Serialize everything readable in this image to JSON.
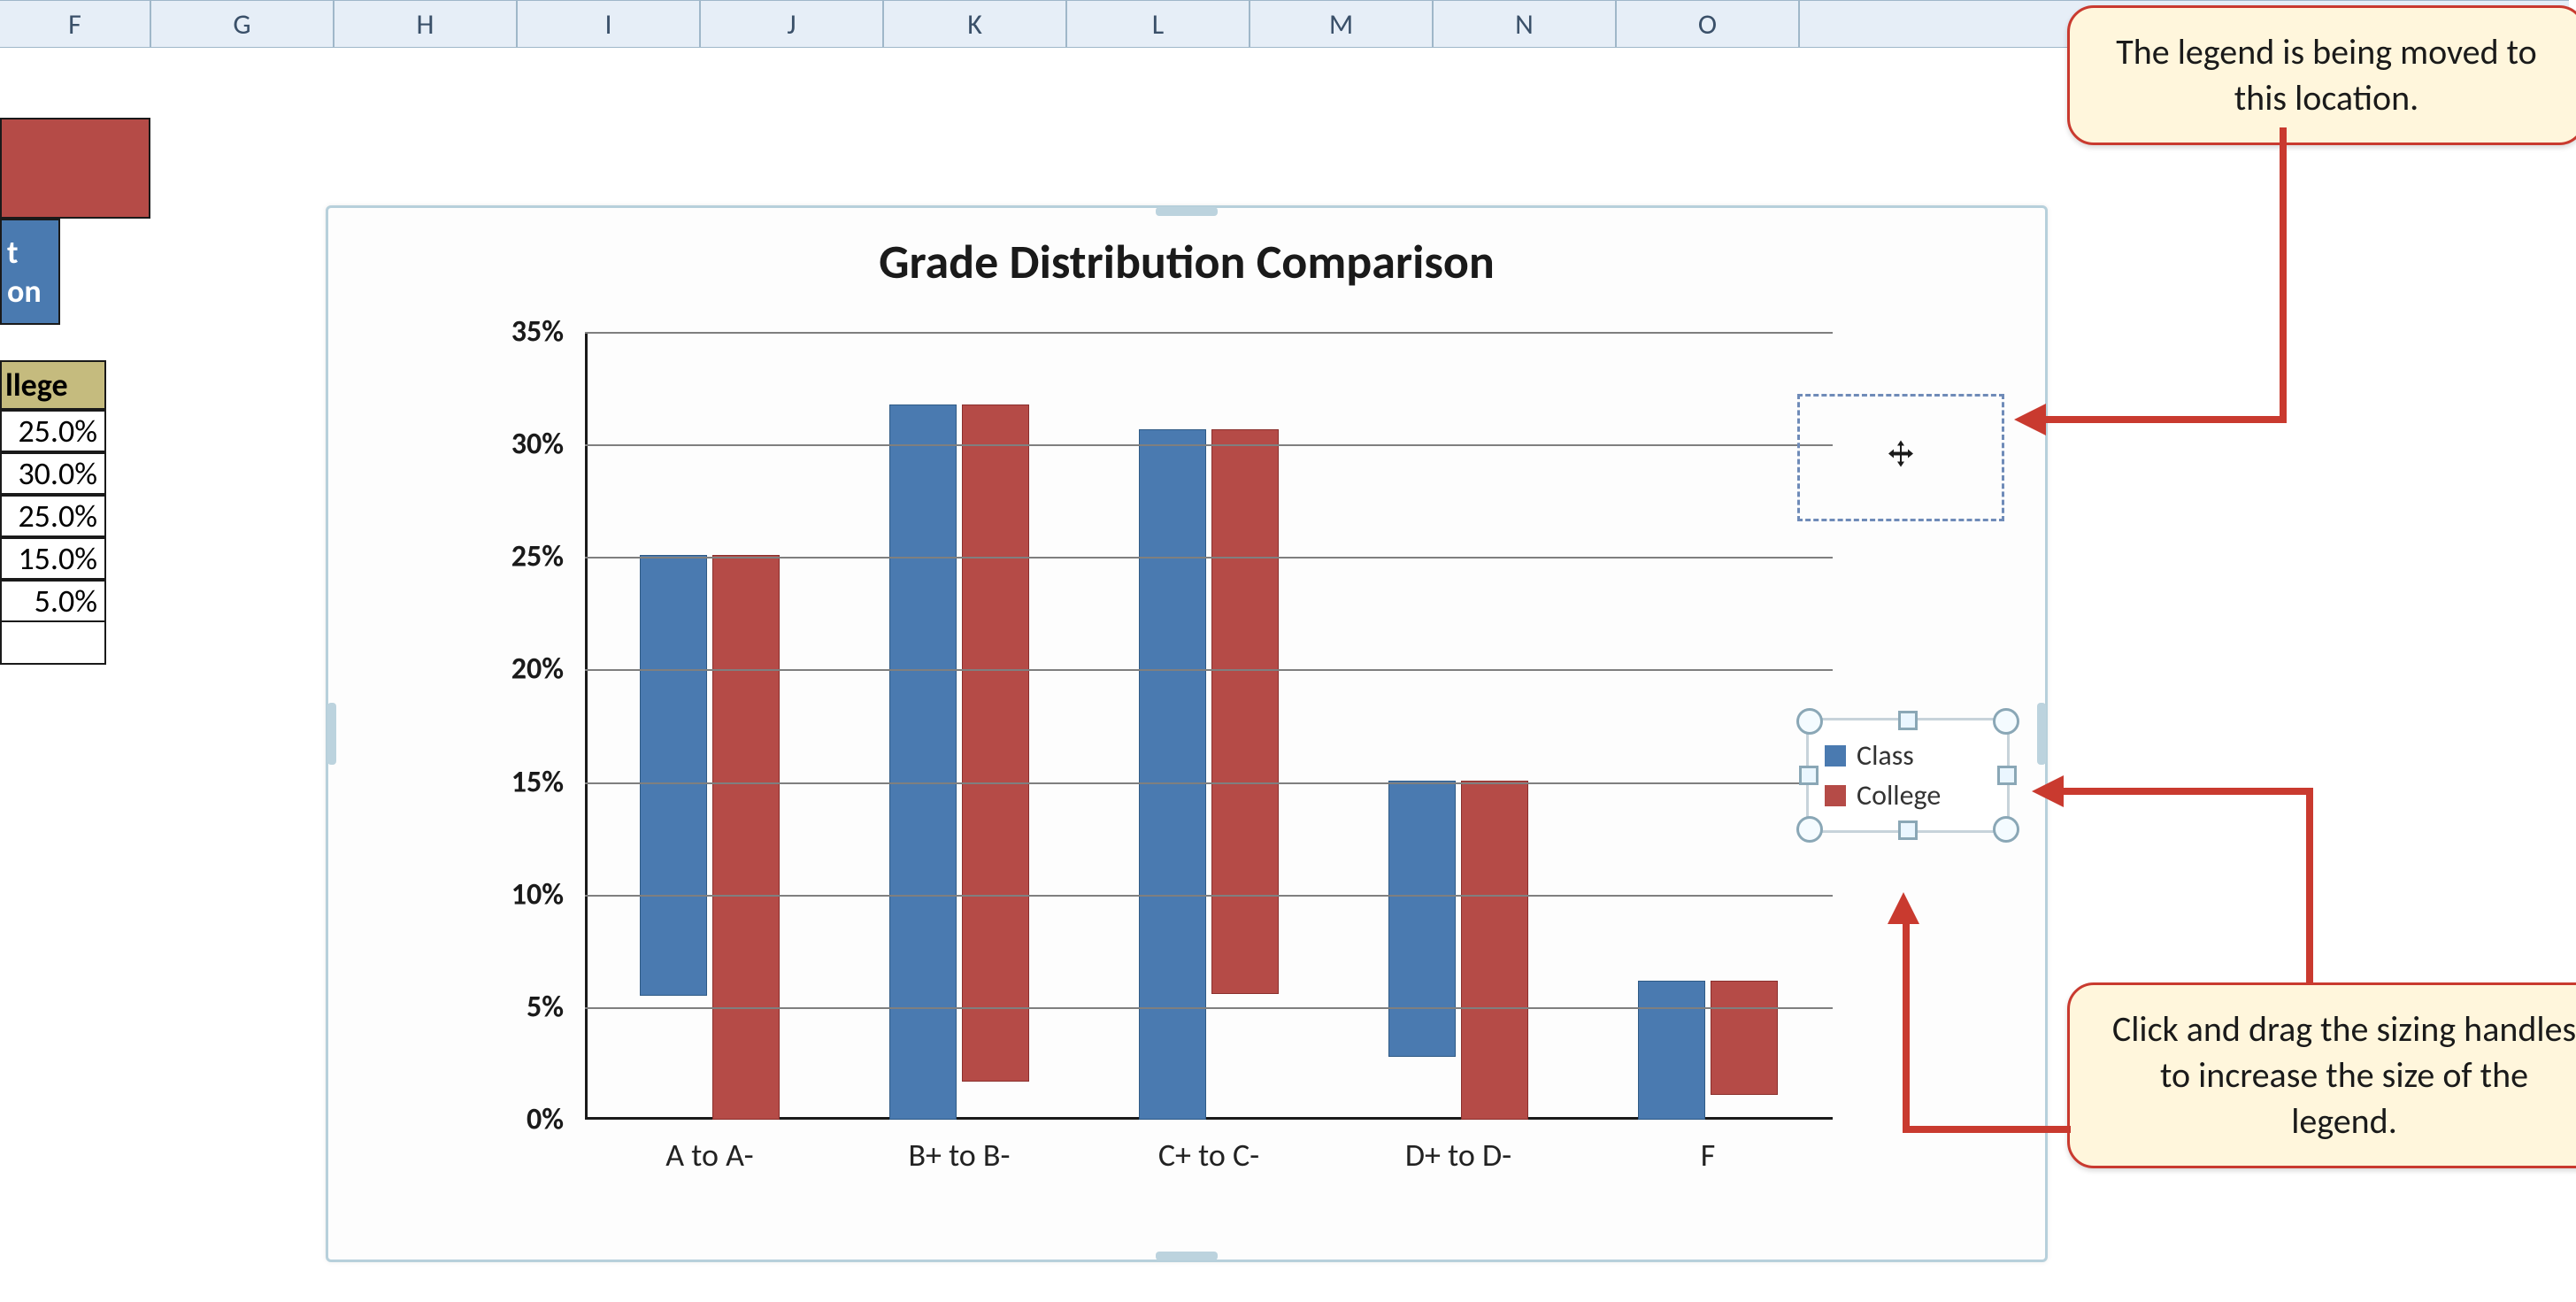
{
  "columns": [
    "F",
    "G",
    "H",
    "I",
    "J",
    "K",
    "L",
    "M",
    "N",
    "O"
  ],
  "partial_left": {
    "t_fragment": "t",
    "on_fragment": "on",
    "llege_fragment": "llege",
    "v0": "25.0%",
    "v1": "30.0%",
    "v2": "25.0%",
    "v3": "15.0%",
    "v4": "5.0%"
  },
  "callouts": {
    "top": "The legend is being moved to this location.",
    "bottom": "Click and drag the sizing handles to increase the size of the legend."
  },
  "legend": {
    "s0": "Class",
    "s1": "College"
  },
  "chart_data": {
    "type": "bar",
    "title": "Grade Distribution  Comparison",
    "xlabel": "",
    "ylabel": "",
    "ylim": [
      0,
      35
    ],
    "yticks": [
      "0%",
      "5%",
      "10%",
      "15%",
      "20%",
      "25%",
      "30%",
      "35%"
    ],
    "categories": [
      "A to A-",
      "B+ to B-",
      "C+ to C-",
      "D+ to D-",
      "F"
    ],
    "series": [
      {
        "name": "Class",
        "values": [
          19.5,
          31.7,
          30.6,
          12.2,
          6.1
        ]
      },
      {
        "name": "College",
        "values": [
          25.0,
          30.0,
          25.0,
          15.0,
          5.0
        ]
      }
    ]
  }
}
